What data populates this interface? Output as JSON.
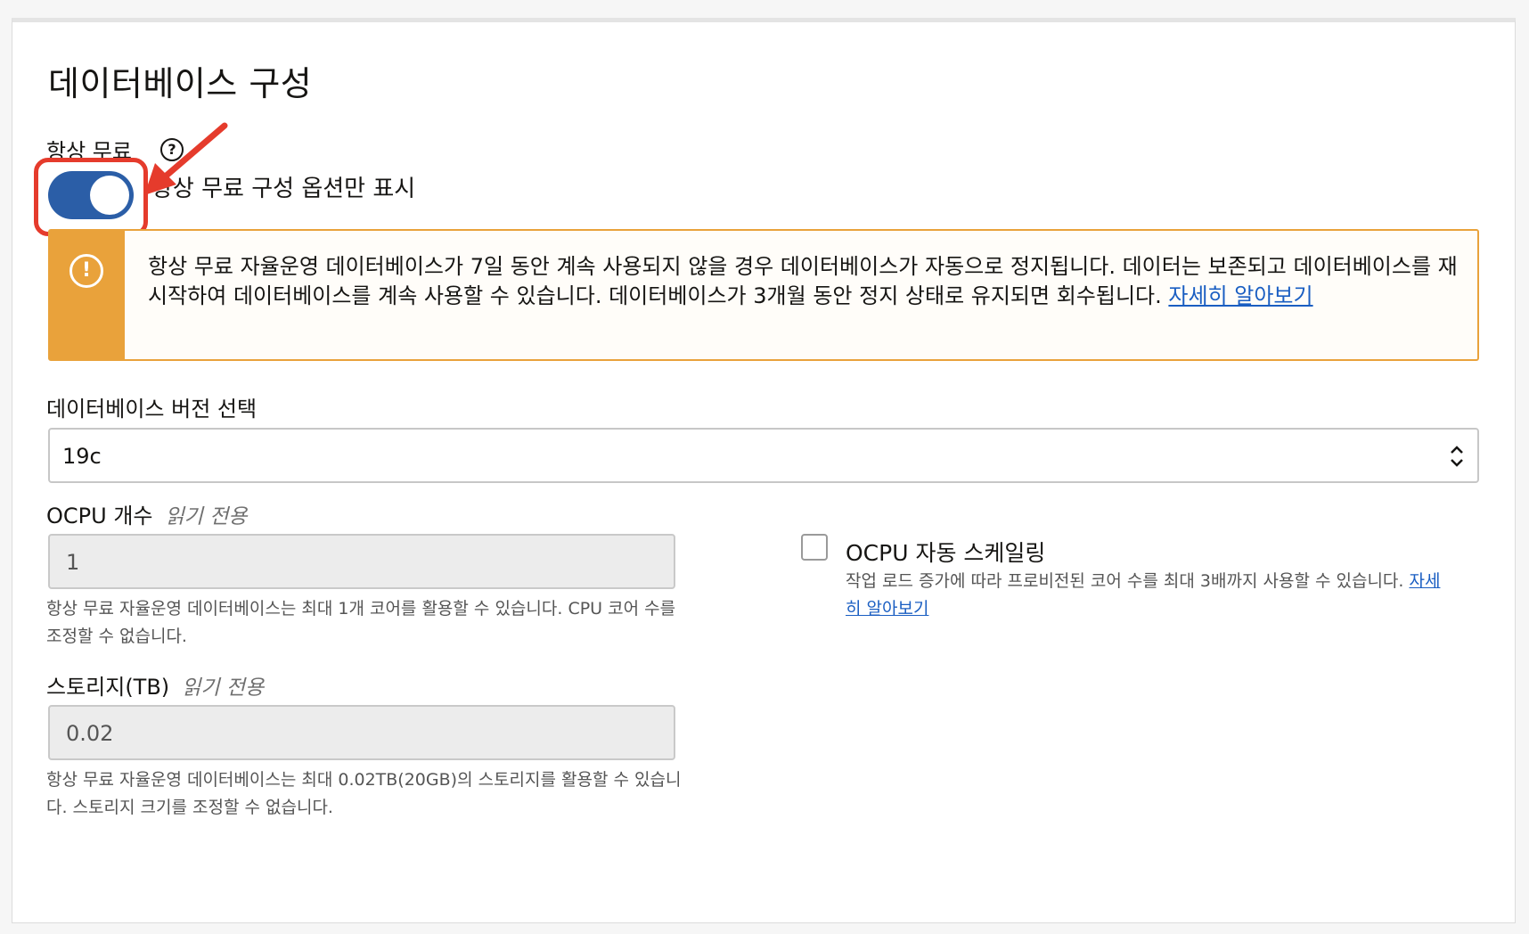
{
  "section": {
    "title": "데이터베이스 구성"
  },
  "always_free": {
    "label": "항상 무료",
    "help_icon": "?",
    "toggle_on": true,
    "toggle_label": "항상 무료 구성 옵션만 표시"
  },
  "warning": {
    "icon": "!",
    "text": "항상 무료 자율운영 데이터베이스가 7일 동안 계속 사용되지 않을 경우 데이터베이스가 자동으로 정지됩니다. 데이터는 보존되고 데이터베이스를 재시작하여 데이터베이스를 계속 사용할 수 있습니다. 데이터베이스가 3개월 동안 정지 상태로 유지되면 회수됩니다. ",
    "link": "자세히 알아보기",
    "accent_color": "#e9a23b"
  },
  "db_version": {
    "label": "데이터베이스 버전 선택",
    "selected": "19c"
  },
  "ocpu": {
    "label": "OCPU 개수",
    "readonly_tag": "읽기 전용",
    "value": "1",
    "hint": "항상 무료 자율운영 데이터베이스는 최대 1개 코어를 활용할 수 있습니다. CPU 코어 수를 조정할 수 없습니다."
  },
  "autoscaling": {
    "label": "OCPU 자동 스케일링",
    "checked": false,
    "hint": "작업 로드 증가에 따라 프로비전된 코어 수를 최대 3배까지 사용할 수 있습니다. ",
    "link": "자세히 알아보기"
  },
  "storage": {
    "label": "스토리지(TB)",
    "readonly_tag": "읽기 전용",
    "value": "0.02",
    "hint": "항상 무료 자율운영 데이터베이스는 최대 0.02TB(20GB)의 스토리지를 활용할 수 있습니다. 스토리지 크기를 조정할 수 없습니다."
  },
  "colors": {
    "toggle": "#2b5ea7",
    "highlight": "#e53b2c",
    "link": "#1a5ec2"
  }
}
